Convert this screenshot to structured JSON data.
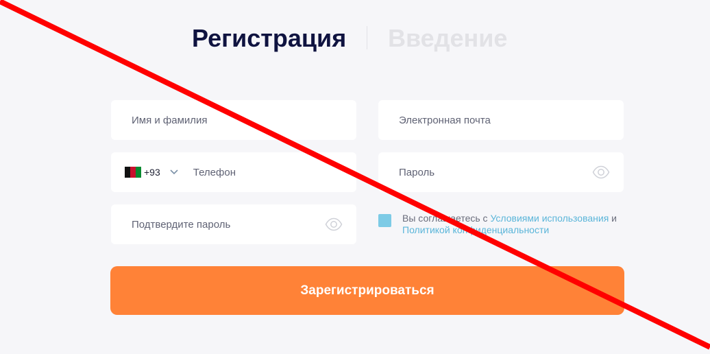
{
  "tabs": {
    "register_label": "Регистрация",
    "login_label": "Введение"
  },
  "form": {
    "name_placeholder": "Имя и фамилия",
    "email_placeholder": "Электронная почта",
    "phone": {
      "country_flag": "afghanistan-flag-icon",
      "dial_code": "+93",
      "placeholder": "Телефон"
    },
    "password_placeholder": "Пароль",
    "confirm_password_placeholder": "Подтвердите пароль"
  },
  "terms": {
    "prefix": "Вы соглашаетесь с ",
    "terms_link": "Условиями использования",
    "conjunction": " и",
    "privacy_link": "Политикой конфиденциальности",
    "checked": true
  },
  "submit_label": "Зарегистрироваться",
  "overlay": {
    "strike_line_icon": "red-diagonal-strike",
    "color": "#ff0000"
  },
  "colors": {
    "accent": "#ff8237",
    "link": "#5ab5d9",
    "title": "#0f1340",
    "checkbox": "#7dcbe6"
  }
}
